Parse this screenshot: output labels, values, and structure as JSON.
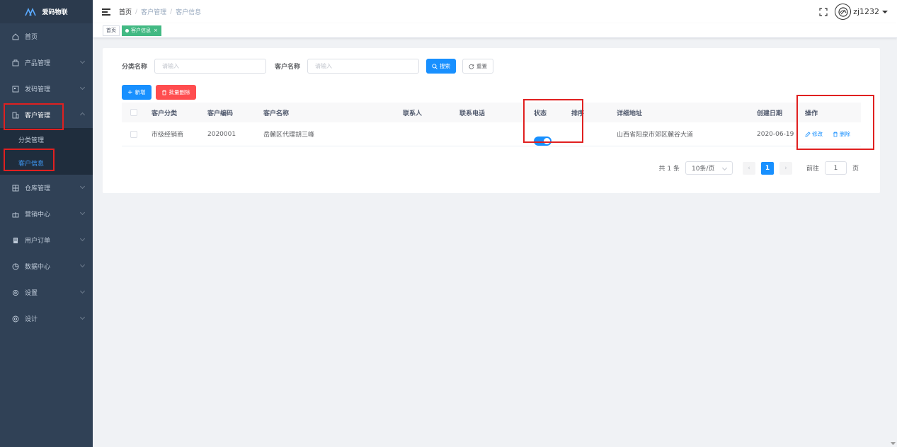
{
  "app": {
    "logo_text": "爱码物联"
  },
  "sidebar": {
    "items": [
      {
        "label": "首页",
        "icon": "home-icon"
      },
      {
        "label": "产品管理",
        "icon": "product-icon"
      },
      {
        "label": "发码管理",
        "icon": "code-icon"
      },
      {
        "label": "客户管理",
        "icon": "customer-icon"
      },
      {
        "label": "仓库管理",
        "icon": "warehouse-icon"
      },
      {
        "label": "营销中心",
        "icon": "marketing-icon"
      },
      {
        "label": "用户订单",
        "icon": "order-icon"
      },
      {
        "label": "数据中心",
        "icon": "data-icon"
      },
      {
        "label": "设置",
        "icon": "settings-icon"
      },
      {
        "label": "设计",
        "icon": "design-icon"
      }
    ],
    "customer_submenu": [
      {
        "label": "分类管理"
      },
      {
        "label": "客户信息"
      }
    ]
  },
  "navbar": {
    "breadcrumb": [
      "首页",
      "客户管理",
      "客户信息"
    ],
    "username": "zj1232"
  },
  "tags": {
    "home": "首页",
    "current": "客户信息",
    "close": "×"
  },
  "search": {
    "category_label": "分类名称",
    "category_placeholder": "请输入",
    "customer_label": "客户名称",
    "customer_placeholder": "请输入",
    "search_button": "搜索",
    "reset_button": "重置"
  },
  "actions": {
    "add_button": "新增",
    "batch_delete_button": "批量删除"
  },
  "table": {
    "columns": [
      "客户分类",
      "客户编码",
      "客户名称",
      "联系人",
      "联系电话",
      "状态",
      "排序",
      "详细地址",
      "创建日期",
      "操作"
    ],
    "rows": [
      {
        "category": "市级经销商",
        "code": "2020001",
        "name": "岳麓区代理胡三峰",
        "contact": "",
        "phone": "",
        "status_on": true,
        "sort": "",
        "address": "山西省阳泉市郊区麓谷大道",
        "created": "2020-06-19",
        "edit_label": "修改",
        "delete_label": "删除"
      }
    ]
  },
  "pagination": {
    "total_text": "共 1 条",
    "page_size": "10条/页",
    "current_page": "1",
    "goto_label": "前往",
    "goto_value": "1",
    "page_suffix": "页"
  },
  "colors": {
    "primary": "#1890ff",
    "danger": "#ff4d4f",
    "sidebar_bg": "#304156",
    "tag_active": "#42b983",
    "annotation_red": "#e02020"
  }
}
